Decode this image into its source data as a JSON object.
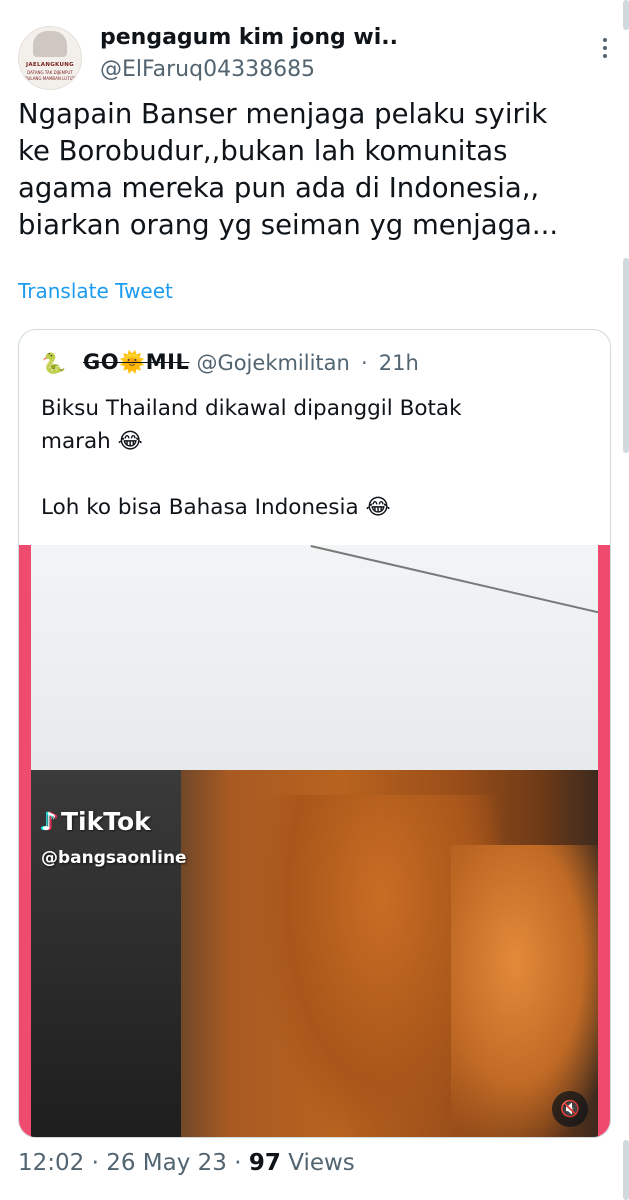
{
  "author": {
    "display_name": "pengagum kim jong wi..",
    "handle": "@ElFaruq04338685",
    "avatar_text": {
      "line1": "JAELANGKUNG",
      "line2": "DATANG TAK DIJEMPUT",
      "line3": "PULANG MAMBAN LUTUT"
    }
  },
  "tweet": {
    "text": "Ngapain Banser menjaga pelaku syirik\nke Borobudur,,bukan lah komunitas\nagama mereka pun ada di Indonesia,,\nbiarkan orang yg seiman yg menjaga...",
    "translate_label": "Translate Tweet"
  },
  "quoted_tweet": {
    "avatar_icon": "🐍",
    "display_name": "GO🌞MIL",
    "handle": "@Gojekmilitan",
    "separator": "·",
    "time": "21h",
    "text": "Biksu Thailand dikawal dipanggil Botak\nmarah 😂\n\nLoh ko bisa Bahasa Indonesia 😂",
    "media": {
      "watermark_brand": "TikTok",
      "watermark_note": "♪",
      "watermark_handle": "@bangsaonline",
      "mute_icon": "🔇",
      "frame_color": "#ef4b6f"
    }
  },
  "meta": {
    "time": "12:02",
    "sep1": "·",
    "date": "26 May 23",
    "sep2": "·",
    "views_count": "97",
    "views_label": "Views"
  },
  "colors": {
    "link": "#1d9bf0",
    "secondary_text": "#536471",
    "primary_text": "#0f1419",
    "border": "#cfd9de"
  }
}
